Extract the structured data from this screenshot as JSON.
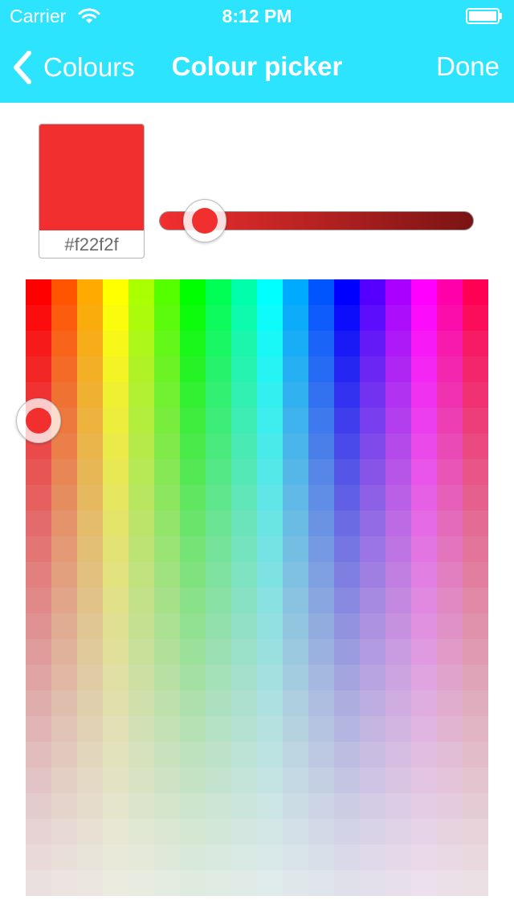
{
  "status_bar": {
    "carrier": "Carrier",
    "time": "8:12 PM"
  },
  "nav": {
    "back_label": "Colours",
    "title": "Colour picker",
    "done_label": "Done"
  },
  "header_color": "#2de4ff",
  "selected": {
    "hex": "#f22f2f",
    "color": "#f22f2f",
    "brightness": 0.1,
    "palette_column": 0,
    "palette_row": 5
  },
  "slider_gradient": [
    "#f22f2f",
    "#7a1414"
  ],
  "palette": {
    "columns": 18,
    "rows": 24,
    "hue_start": 0,
    "hue_end": 340
  },
  "icons": {
    "back": "chevron-left-icon",
    "wifi": "wifi-icon",
    "battery": "battery-icon"
  }
}
